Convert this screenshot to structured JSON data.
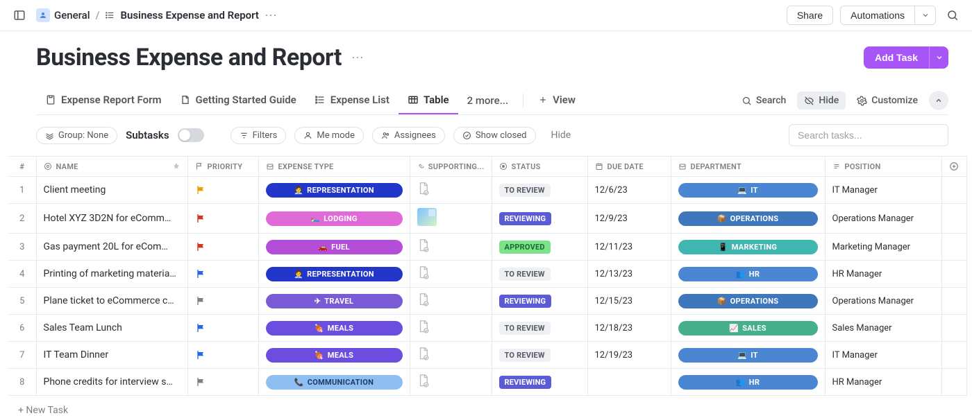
{
  "breadcrumb": {
    "workspace": "General",
    "page": "Business Expense and Report"
  },
  "topbar": {
    "share": "Share",
    "automations": "Automations"
  },
  "title": "Business Expense and Report",
  "add_task": "Add Task",
  "tabs": {
    "form": "Expense Report Form",
    "guide": "Getting Started Guide",
    "list": "Expense List",
    "table": "Table",
    "more": "2 more...",
    "view": "View"
  },
  "toolbar": {
    "search": "Search",
    "hide": "Hide",
    "customize": "Customize"
  },
  "filters": {
    "group": "Group: None",
    "subtasks": "Subtasks",
    "filters": "Filters",
    "me_mode": "Me mode",
    "assignees": "Assignees",
    "show_closed": "Show closed",
    "hide": "Hide",
    "search_placeholder": "Search tasks..."
  },
  "columns": {
    "num": "#",
    "name": "NAME",
    "priority": "PRIORITY",
    "expense_type": "EXPENSE TYPE",
    "supporting": "SUPPORTING...",
    "status": "STATUS",
    "due_date": "DUE DATE",
    "department": "DEPARTMENT",
    "position": "POSITION"
  },
  "expense_type_icons": {
    "representation": "🧑‍💼",
    "lodging": "🛏️",
    "fuel": "🚗",
    "travel": "✈",
    "meals": "🍖",
    "communication": "📞"
  },
  "department_icons": {
    "it": "💻",
    "operations": "📦",
    "marketing": "📱",
    "hr": "👥",
    "sales": "📈"
  },
  "rows": [
    {
      "n": "1",
      "name": "Client meeting",
      "flag_color": "#e0a106",
      "et_label": "REPRESENTATION",
      "et_class": "et-representation",
      "et_icon": "representation",
      "supp": "doc",
      "status": "TO REVIEW",
      "status_class": "status-toreview",
      "due": "12/6/23",
      "dept_label": "IT",
      "dept_class": "dept-it",
      "dept_icon": "it",
      "position": "IT Manager"
    },
    {
      "n": "2",
      "name": "Hotel XYZ 3D2N for eComm…",
      "flag_color": "#c0392b",
      "et_label": "LODGING",
      "et_class": "et-lodging",
      "et_icon": "lodging",
      "supp": "thumb",
      "status": "REVIEWING",
      "status_class": "status-reviewing",
      "due": "12/9/23",
      "dept_label": "OPERATIONS",
      "dept_class": "dept-ops",
      "dept_icon": "operations",
      "position": "Operations Manager"
    },
    {
      "n": "3",
      "name": "Gas payment 20L for eCom…",
      "flag_color": "#c0392b",
      "et_label": "FUEL",
      "et_class": "et-fuel",
      "et_icon": "fuel",
      "supp": "doc",
      "status": "APPROVED",
      "status_class": "status-approved",
      "due": "12/11/23",
      "dept_label": "MARKETING",
      "dept_class": "dept-mkt",
      "dept_icon": "marketing",
      "position": "Marketing Manager"
    },
    {
      "n": "4",
      "name": "Printing of marketing materia…",
      "flag_color": "#2f66d4",
      "et_label": "REPRESENTATION",
      "et_class": "et-representation",
      "et_icon": "representation",
      "supp": "doc",
      "status": "TO REVIEW",
      "status_class": "status-toreview",
      "due": "12/13/23",
      "dept_label": "HR",
      "dept_class": "dept-hr",
      "dept_icon": "hr",
      "position": "HR Manager"
    },
    {
      "n": "5",
      "name": "Plane ticket to eCommerce c…",
      "flag_color": "#7b8087",
      "et_label": "TRAVEL",
      "et_class": "et-travel",
      "et_icon": "travel",
      "supp": "doc",
      "status": "REVIEWING",
      "status_class": "status-reviewing",
      "due": "12/15/23",
      "dept_label": "OPERATIONS",
      "dept_class": "dept-ops",
      "dept_icon": "operations",
      "position": "Operations Manager"
    },
    {
      "n": "6",
      "name": "Sales Team Lunch",
      "flag_color": "#2f66d4",
      "et_label": "MEALS",
      "et_class": "et-meals",
      "et_icon": "meals",
      "supp": "doc",
      "status": "TO REVIEW",
      "status_class": "status-toreview",
      "due": "12/18/23",
      "dept_label": "SALES",
      "dept_class": "dept-sales",
      "dept_icon": "sales",
      "position": "Sales Manager"
    },
    {
      "n": "7",
      "name": "IT Team Dinner",
      "flag_color": "#2f66d4",
      "et_label": "MEALS",
      "et_class": "et-meals",
      "et_icon": "meals",
      "supp": "doc",
      "status": "TO REVIEW",
      "status_class": "status-toreview",
      "due": "12/19/23",
      "dept_label": "IT",
      "dept_class": "dept-it",
      "dept_icon": "it",
      "position": "IT Manager"
    },
    {
      "n": "8",
      "name": "Phone credits for interview s…",
      "flag_color": "#7b8087",
      "et_label": "COMMUNICATION",
      "et_class": "et-communication",
      "et_icon": "communication",
      "supp": "doc",
      "status": "REVIEWING",
      "status_class": "status-reviewing",
      "due": "",
      "dept_label": "HR",
      "dept_class": "dept-hr",
      "dept_icon": "hr",
      "position": "HR Manager"
    }
  ],
  "new_task": "+ New Task"
}
